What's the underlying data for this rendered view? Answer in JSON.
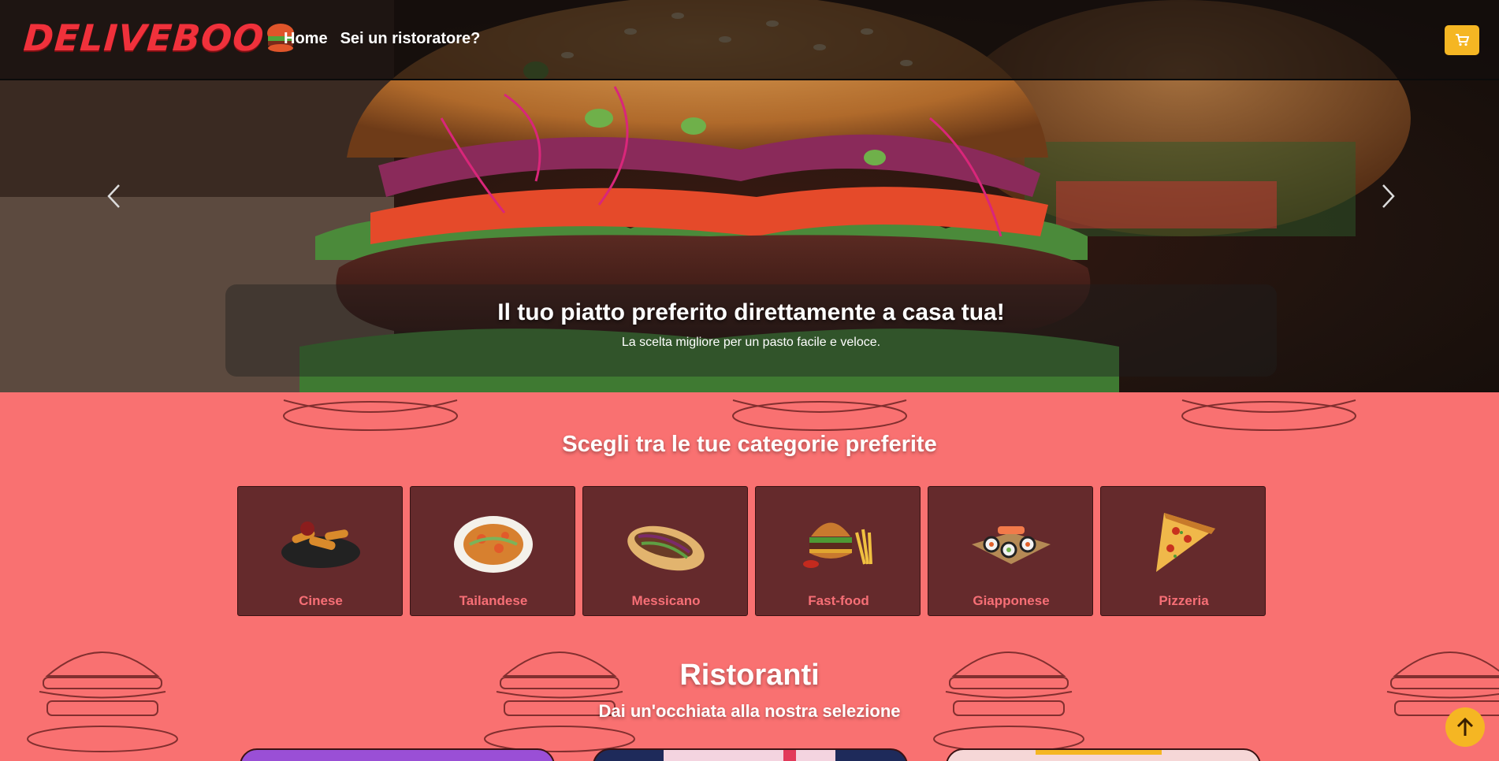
{
  "brand": {
    "logo_text": "DELIVEBOO"
  },
  "nav": {
    "links": [
      {
        "label": "Home"
      },
      {
        "label": "Sei un ristoratore?"
      }
    ],
    "cart_icon": "cart-icon"
  },
  "hero": {
    "title": "Il tuo piatto preferito direttamente a casa tua!",
    "subtitle": "La scelta migliore per un pasto facile e veloce.",
    "prev_icon": "chevron-left-icon",
    "next_icon": "chevron-right-icon"
  },
  "categories": {
    "title": "Scegli tra le tue categorie preferite",
    "items": [
      {
        "label": "Cinese",
        "icon": "spring-rolls-icon"
      },
      {
        "label": "Tailandese",
        "icon": "noodle-plate-icon"
      },
      {
        "label": "Messicano",
        "icon": "burrito-icon"
      },
      {
        "label": "Fast-food",
        "icon": "burger-fries-icon"
      },
      {
        "label": "Giapponese",
        "icon": "sushi-icon"
      },
      {
        "label": "Pizzeria",
        "icon": "pizza-slice-icon"
      }
    ]
  },
  "restaurants": {
    "title": "Ristoranti",
    "subtitle": "Dai un'occhiata alla nostra selezione"
  },
  "colors": {
    "accent": "#f5b623",
    "background": "#f97171",
    "card": "#652a2c",
    "brand_red": "#f0313b"
  }
}
